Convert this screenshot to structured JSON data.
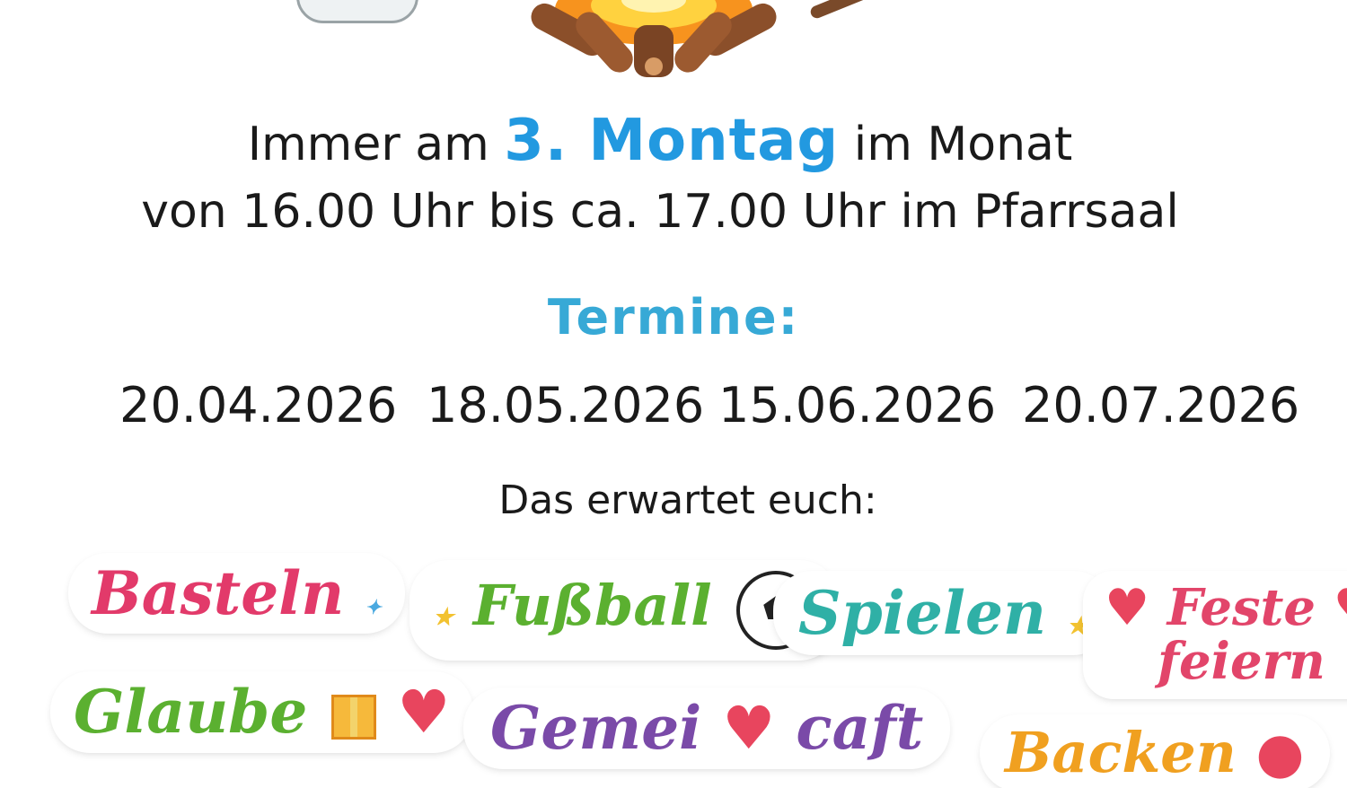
{
  "schedule": {
    "line1_before": "Immer am",
    "line1_highlight": "3. Montag",
    "line1_after": "im Monat",
    "line2": "von 16.00 Uhr bis ca. 17.00 Uhr im Pfarrsaal"
  },
  "termine": {
    "heading": "Termine:",
    "dates": [
      "20.04.2026",
      "18.05.2026",
      "15.06.2026",
      "20.07.2026"
    ]
  },
  "expect": {
    "heading": "Das erwartet euch:",
    "activities": [
      "Basteln",
      "Fußball",
      "Spielen",
      "Feste",
      "feiern",
      "Glaube",
      "Gemei",
      "caft",
      "Backen"
    ]
  },
  "icons": {
    "top": [
      "cup-icon",
      "campfire-icon",
      "stick-icon"
    ],
    "stickers": [
      "soccer-ball-icon",
      "gift-icon",
      "heart-icon",
      "handshake-heart-icon",
      "candy-icon"
    ]
  },
  "colors": {
    "highlight": "#2299e0",
    "termine": "#37a9d6",
    "basteln": "#e23a6a",
    "fussball": "#5bb030",
    "spielen": "#2fb0a6",
    "feste": "#e2456a",
    "gemeinschaft": "#7a4aa8",
    "backen": "#f0a020"
  }
}
